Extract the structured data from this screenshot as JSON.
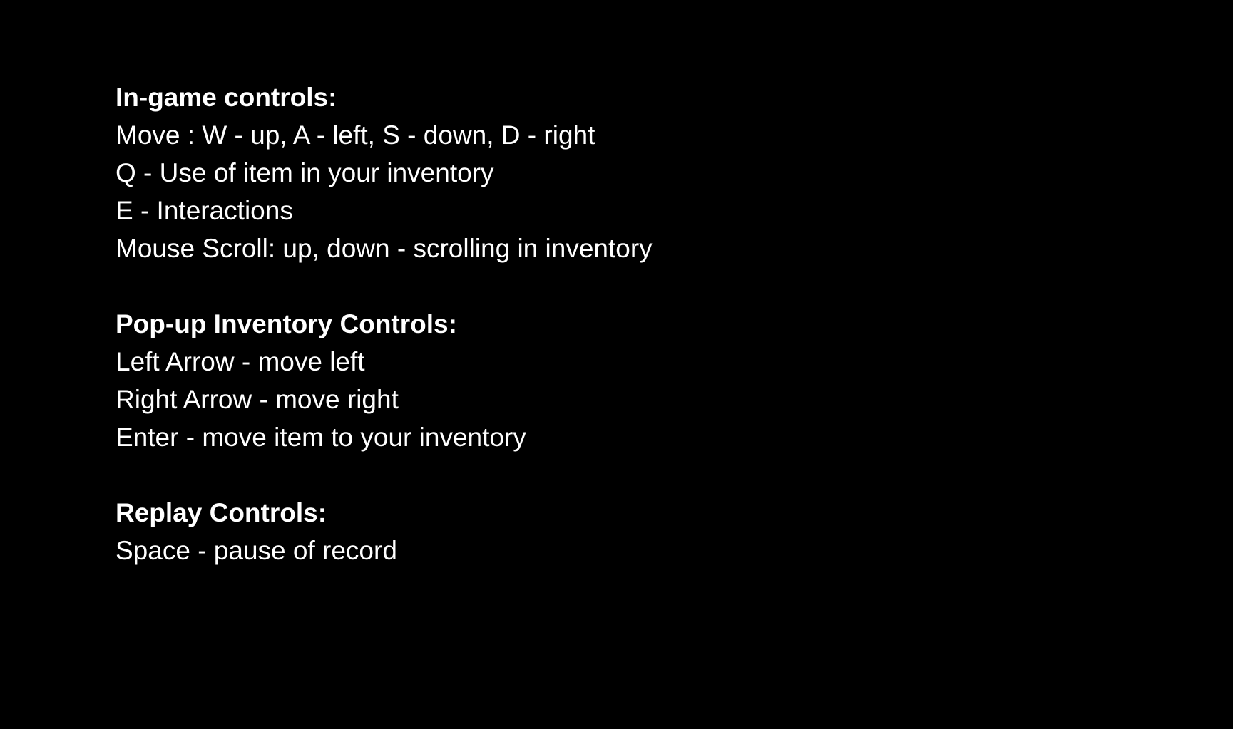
{
  "colors": {
    "background": "#000000",
    "text": "#ffffff"
  },
  "sections": [
    {
      "heading": "In-game controls:",
      "lines": [
        "Move : W - up, A - left, S - down, D - right",
        "Q - Use of item in your inventory",
        "E - Interactions",
        "Mouse Scroll: up, down - scrolling in inventory"
      ]
    },
    {
      "heading": "Pop-up Inventory Controls:",
      "lines": [
        "Left Arrow - move left",
        "Right Arrow - move right",
        "Enter - move item to your inventory"
      ]
    },
    {
      "heading": "Replay Controls:",
      "lines": [
        "Space - pause of record"
      ]
    }
  ]
}
